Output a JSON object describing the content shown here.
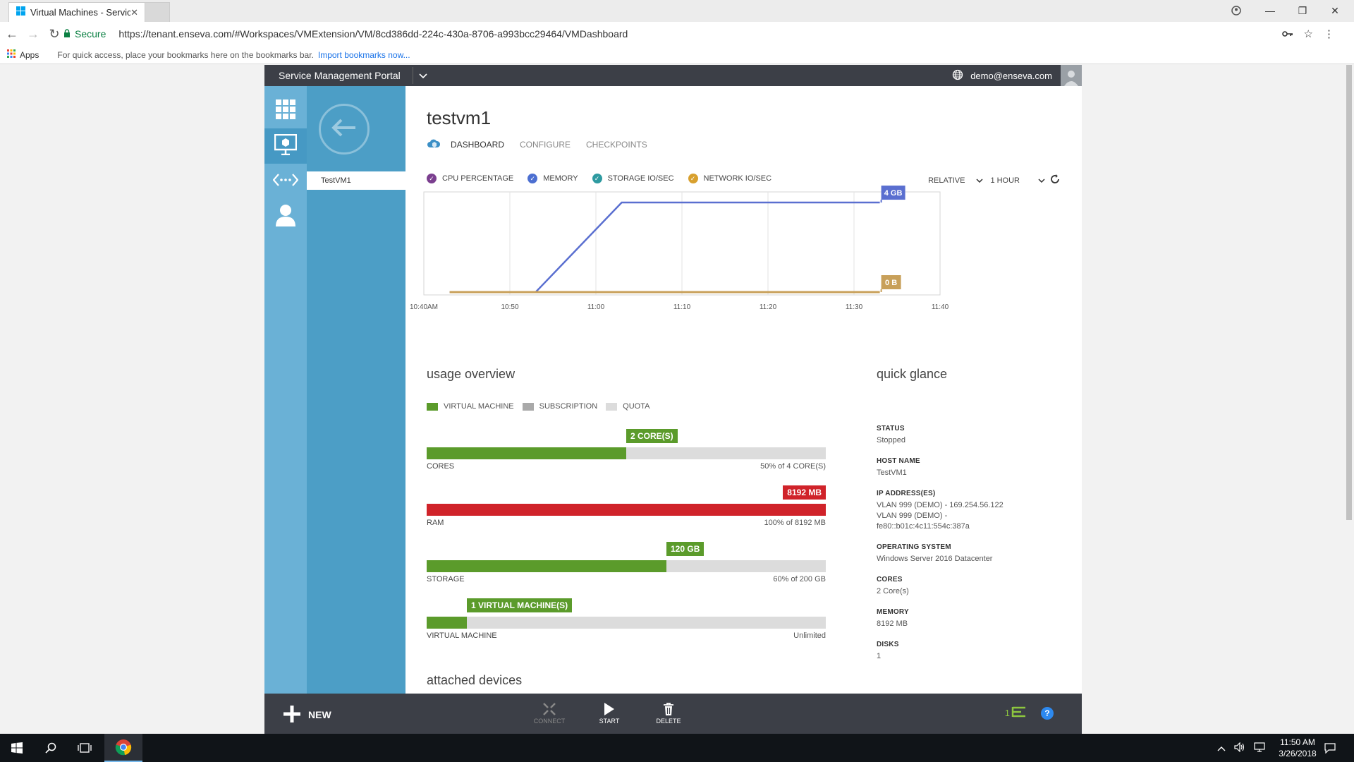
{
  "browser": {
    "tab_title": "Virtual Machines - Servic",
    "secure_label": "Secure",
    "url": "https://tenant.enseva.com/#Workspaces/VMExtension/VM/8cd386dd-224c-430a-8706-a993bcc29464/VMDashboard",
    "bookmarks": {
      "apps_label": "Apps",
      "hint": "For quick access, place your bookmarks here on the bookmarks bar.",
      "import_link": "Import bookmarks now..."
    }
  },
  "portal": {
    "title": "Service Management Portal",
    "user_email": "demo@enseva.com"
  },
  "subnav": {
    "item": "TestVM1"
  },
  "page": {
    "vm_title": "testvm1",
    "tabs": [
      {
        "label": "DASHBOARD"
      },
      {
        "label": "CONFIGURE"
      },
      {
        "label": "CHECKPOINTS"
      }
    ]
  },
  "chart_legend": [
    {
      "label": "CPU PERCENTAGE",
      "color": "#7b3f8f"
    },
    {
      "label": "MEMORY",
      "color": "#4c6fd1"
    },
    {
      "label": "STORAGE IO/SEC",
      "color": "#2e9aa0"
    },
    {
      "label": "NETWORK IO/SEC",
      "color": "#d8a02e"
    }
  ],
  "chart_controls": {
    "mode": "RELATIVE",
    "range": "1 HOUR"
  },
  "chart_data": {
    "type": "line",
    "x_ticks": [
      "10:40AM",
      "10:50",
      "11:00",
      "11:10",
      "11:20",
      "11:30",
      "11:40"
    ],
    "series": [
      {
        "name": "MEMORY",
        "color": "#5a6fd0",
        "x": [
          "10:43",
          "10:53",
          "11:03",
          "11:33"
        ],
        "y": [
          0,
          0,
          4,
          4
        ],
        "end_label": "4 GB"
      },
      {
        "name": "NETWORK IO/SEC",
        "color": "#c8a05a",
        "x": [
          "10:43",
          "11:33"
        ],
        "y": [
          0,
          0
        ],
        "end_label": "0 B"
      }
    ],
    "y_unit": "GB",
    "ylim": [
      0,
      4.6
    ],
    "grid": true
  },
  "usage": {
    "title": "usage overview",
    "legend": [
      {
        "label": "VIRTUAL MACHINE",
        "color": "#5b9b2b"
      },
      {
        "label": "SUBSCRIPTION",
        "color": "#a9a9a9"
      },
      {
        "label": "QUOTA",
        "color": "#dcdcdc"
      }
    ],
    "bars": [
      {
        "label": "CORES",
        "tag": "2 CORE(S)",
        "value_text": "50% of 4 CORE(S)",
        "fraction": 0.5,
        "color": "#5b9b2b"
      },
      {
        "label": "RAM",
        "tag": "8192 MB",
        "value_text": "100% of 8192 MB",
        "fraction": 1.0,
        "color": "#d0232a"
      },
      {
        "label": "STORAGE",
        "tag": "120 GB",
        "value_text": "60% of 200 GB",
        "fraction": 0.6,
        "color": "#5b9b2b"
      },
      {
        "label": "VIRTUAL MACHINE",
        "tag": "1 VIRTUAL MACHINE(S)",
        "value_text": "Unlimited",
        "fraction": 0.1,
        "color": "#5b9b2b"
      }
    ],
    "attached_title": "attached devices"
  },
  "glance": {
    "title": "quick glance",
    "items": [
      {
        "label": "STATUS",
        "value": "Stopped"
      },
      {
        "label": "HOST NAME",
        "value": "TestVM1"
      },
      {
        "label": "IP ADDRESS(ES)",
        "value": "VLAN 999 (DEMO) - 169.254.56.122"
      },
      {
        "label": "OPERATING SYSTEM",
        "value": "Windows Server 2016 Datacenter"
      },
      {
        "label": "CORES",
        "value": "2 Core(s)"
      },
      {
        "label": "MEMORY",
        "value": "8192 MB"
      },
      {
        "label": "DISKS",
        "value": "1"
      }
    ],
    "ip_extra_1": "VLAN 999 (DEMO) -",
    "ip_extra_2": "fe80::b01c:4c11:554c:387a"
  },
  "commands": {
    "new": "NEW",
    "connect": "CONNECT",
    "start": "START",
    "delete": "DELETE",
    "notif_count": "1"
  },
  "taskbar": {
    "time": "11:50 AM",
    "date": "3/26/2018"
  }
}
